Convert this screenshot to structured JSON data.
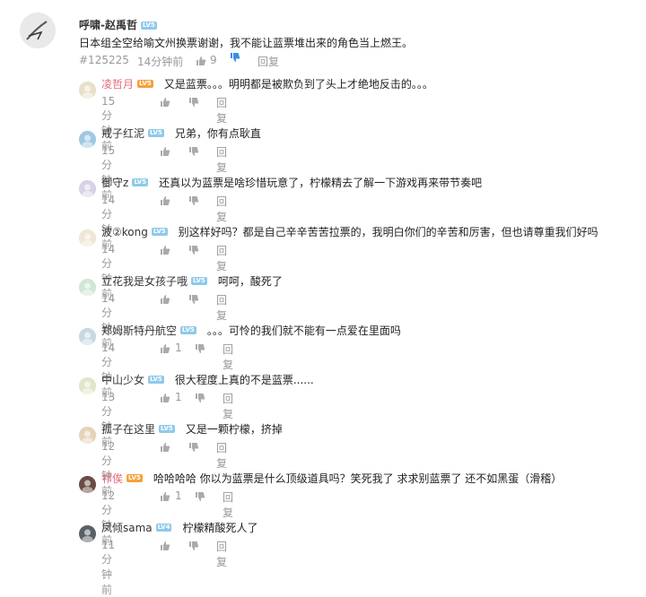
{
  "main_comment": {
    "user": "呼啸-赵禹哲",
    "level": "LV5",
    "text": "日本组全空给喻文州换票谢谢，我不能让蓝票堆出来的角色当上燃王。",
    "floor": "#125225",
    "time": "14分钟前",
    "likes": "9",
    "reply_label": "回复"
  },
  "replies": [
    {
      "user": "凌哲月",
      "level": "LV5",
      "vip": true,
      "text": "又是蓝票。。。明明都是被欺负到了头上才绝地反击的。。。",
      "time": "15分钟前",
      "likes": "",
      "reply_label": "回复"
    },
    {
      "user": "戒子红泥",
      "level": "LV5",
      "vip": false,
      "text": "兄弟，你有点耿直",
      "time": "15分钟前",
      "likes": "",
      "reply_label": "回复"
    },
    {
      "user": "御守z",
      "level": "LV5",
      "vip": false,
      "text": "还真以为蓝票是啥珍惜玩意了，柠檬精去了解一下游戏再来带节奏吧",
      "time": "14分钟前",
      "likes": "",
      "reply_label": "回复"
    },
    {
      "user": "波②kong",
      "level": "LV5",
      "vip": false,
      "text": "别这样好吗？都是自己辛辛苦苦拉票的，我明白你们的辛苦和厉害，但也请尊重我们好吗",
      "time": "14分钟前",
      "likes": "",
      "reply_label": "回复"
    },
    {
      "user": "立花我是女孩子哦",
      "level": "LV5",
      "vip": false,
      "text": "呵呵，酸死了",
      "time": "14分钟前",
      "likes": "",
      "reply_label": "回复"
    },
    {
      "user": "郑姆斯特丹航空",
      "level": "LV5",
      "vip": false,
      "text": "。。。可怜的我们就不能有一点爱在里面吗",
      "time": "14分钟前",
      "likes": "1",
      "reply_label": "回复"
    },
    {
      "user": "中山少女",
      "level": "LV5",
      "vip": false,
      "text": "很大程度上真的不是蓝票......",
      "time": "13分钟前",
      "likes": "1",
      "reply_label": "回复"
    },
    {
      "user": "孤子在这里",
      "level": "LV5",
      "vip": false,
      "text": "又是一颗柠檬，挤掉",
      "time": "12分钟前",
      "likes": "",
      "reply_label": "回复"
    },
    {
      "user": "祁俟",
      "level": "LV5",
      "vip": true,
      "text": "哈哈哈哈 你以为蓝票是什么顶级道具吗？笑死我了 求求别蓝票了 还不如黑蛋（滑稽）",
      "time": "12分钟前",
      "likes": "1",
      "reply_label": "回复"
    },
    {
      "user": "凤倾sama",
      "level": "LV4",
      "vip": false,
      "text": "柠檬精酸死人了",
      "time": "11分钟前",
      "likes": "",
      "reply_label": "回复"
    }
  ],
  "colors": {
    "vip_name": "#e5687a",
    "level_blue": "#8fc9ea",
    "level_orange": "#f5a13b",
    "thumb_down_active": "#3a8ee6"
  },
  "icons": {
    "like": "thumb-up-icon",
    "dislike": "thumb-down-icon"
  }
}
